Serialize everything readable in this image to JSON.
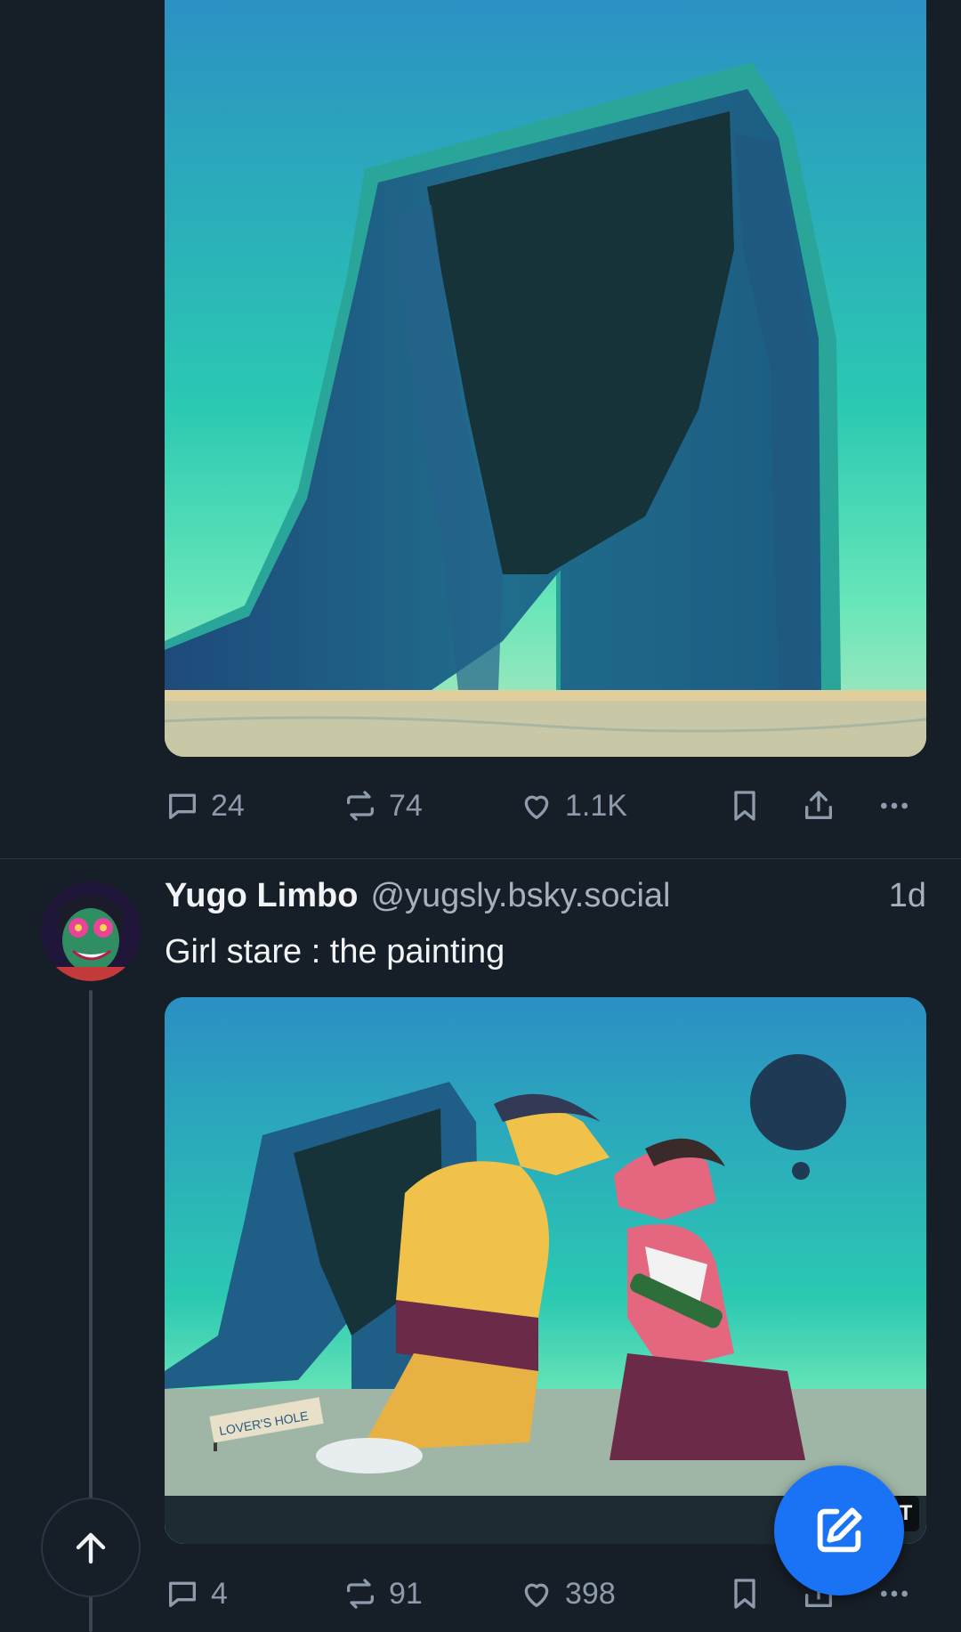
{
  "post1": {
    "media_alt": "Painting of a giant hollow rock arch in a turquoise desert",
    "actions": {
      "replies": "24",
      "reposts": "74",
      "likes": "1.1K"
    }
  },
  "post2": {
    "author": {
      "display_name": "Yugo Limbo",
      "handle": "@yugsly.bsky.social"
    },
    "time": "1d",
    "text": "Girl stare : the painting",
    "media": {
      "sign_text": "LOVER'S HOLE",
      "alt_badge": "T"
    },
    "actions": {
      "replies": "4",
      "reposts": "91",
      "likes": "398"
    }
  },
  "icons": {
    "reply": "speech-bubble-icon",
    "repost": "repost-arrows-icon",
    "like": "heart-icon",
    "bookmark": "bookmark-icon",
    "share": "share-icon",
    "more": "ellipsis-icon",
    "scroll_top": "arrow-up-icon",
    "compose": "pencil-square-icon"
  },
  "colors": {
    "background": "#161e27",
    "accent": "#1a73f5",
    "muted": "#8e9bac"
  }
}
